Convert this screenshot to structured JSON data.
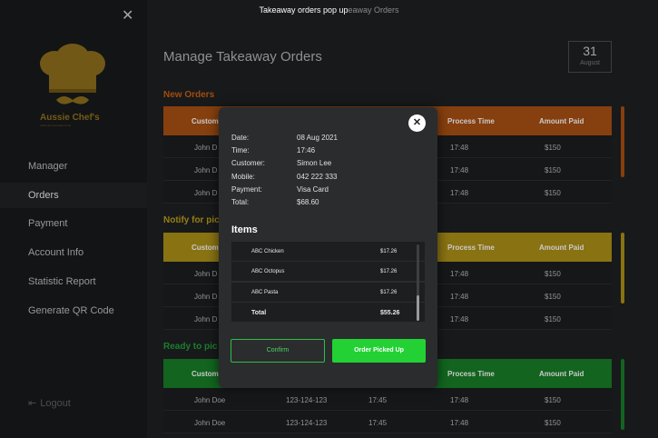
{
  "topbar": {
    "title": "Takeaway orders pop up",
    "subtitle": "eaway Orders"
  },
  "sidebar": {
    "logo_name": "Aussie Chef's",
    "logo_sub": "Authentic Australian Food",
    "items": [
      {
        "label": "Manager"
      },
      {
        "label": "Orders"
      },
      {
        "label": "Payment"
      },
      {
        "label": "Account Info"
      },
      {
        "label": "Statistic Report"
      },
      {
        "label": "Generate QR Code"
      }
    ],
    "logout": "Logout"
  },
  "main": {
    "title": "Manage Takeaway Orders",
    "date": {
      "day": "31",
      "month": "August"
    },
    "sections": [
      {
        "title": "New Orders"
      },
      {
        "title": "Notify for pic"
      },
      {
        "title": "Ready to pic"
      }
    ],
    "headers": {
      "customer": "Custom",
      "process": "Process Time",
      "amount": "Amount Paid"
    },
    "new_rows": [
      {
        "name": "John D",
        "time": "17:48",
        "amount": "$150"
      },
      {
        "name": "John D",
        "time": "17:48",
        "amount": "$150"
      },
      {
        "name": "John D",
        "time": "17:48",
        "amount": "$150"
      }
    ],
    "notify_rows": [
      {
        "name": "John D",
        "time": "17:48",
        "amount": "$150"
      },
      {
        "name": "John D",
        "time": "17:48",
        "amount": "$150"
      },
      {
        "name": "John D",
        "time": "17:48",
        "amount": "$150"
      }
    ],
    "ready_rows": [
      {
        "name": "John Doe",
        "mobile": "123-124-123",
        "order": "17:45",
        "time": "17:48",
        "amount": "$150"
      },
      {
        "name": "John Doe",
        "mobile": "123-124-123",
        "order": "17:45",
        "time": "17:48",
        "amount": "$150"
      }
    ]
  },
  "modal": {
    "labels": {
      "date": "Date:",
      "time": "Time:",
      "customer": "Customer:",
      "mobile": "Mobile:",
      "payment": "Payment:",
      "total": "Total:"
    },
    "values": {
      "date": "08 Aug 2021",
      "time": "17:46",
      "customer": "Simon Lee",
      "mobile": "042 222 333",
      "payment": "Visa Card",
      "total": "$68.60"
    },
    "items_title": "Items",
    "items": [
      {
        "name": "ABC Chicken",
        "price": "$17.26"
      },
      {
        "name": "ABC Octopus",
        "price": "$17.26"
      },
      {
        "name": "ABC Pasta",
        "price": "$17.26"
      }
    ],
    "total": {
      "label": "Total",
      "price": "$55.26"
    },
    "confirm_label": "Confirm",
    "picked_label": "Order Picked Up"
  },
  "colors": {
    "orange": "#a44d12",
    "yellow": "#a88c16",
    "green": "#177a26",
    "accent": "#23d135"
  },
  "icons": [
    "close-icon",
    "logout-icon",
    "chef-hat-icon",
    "mustache-icon"
  ]
}
